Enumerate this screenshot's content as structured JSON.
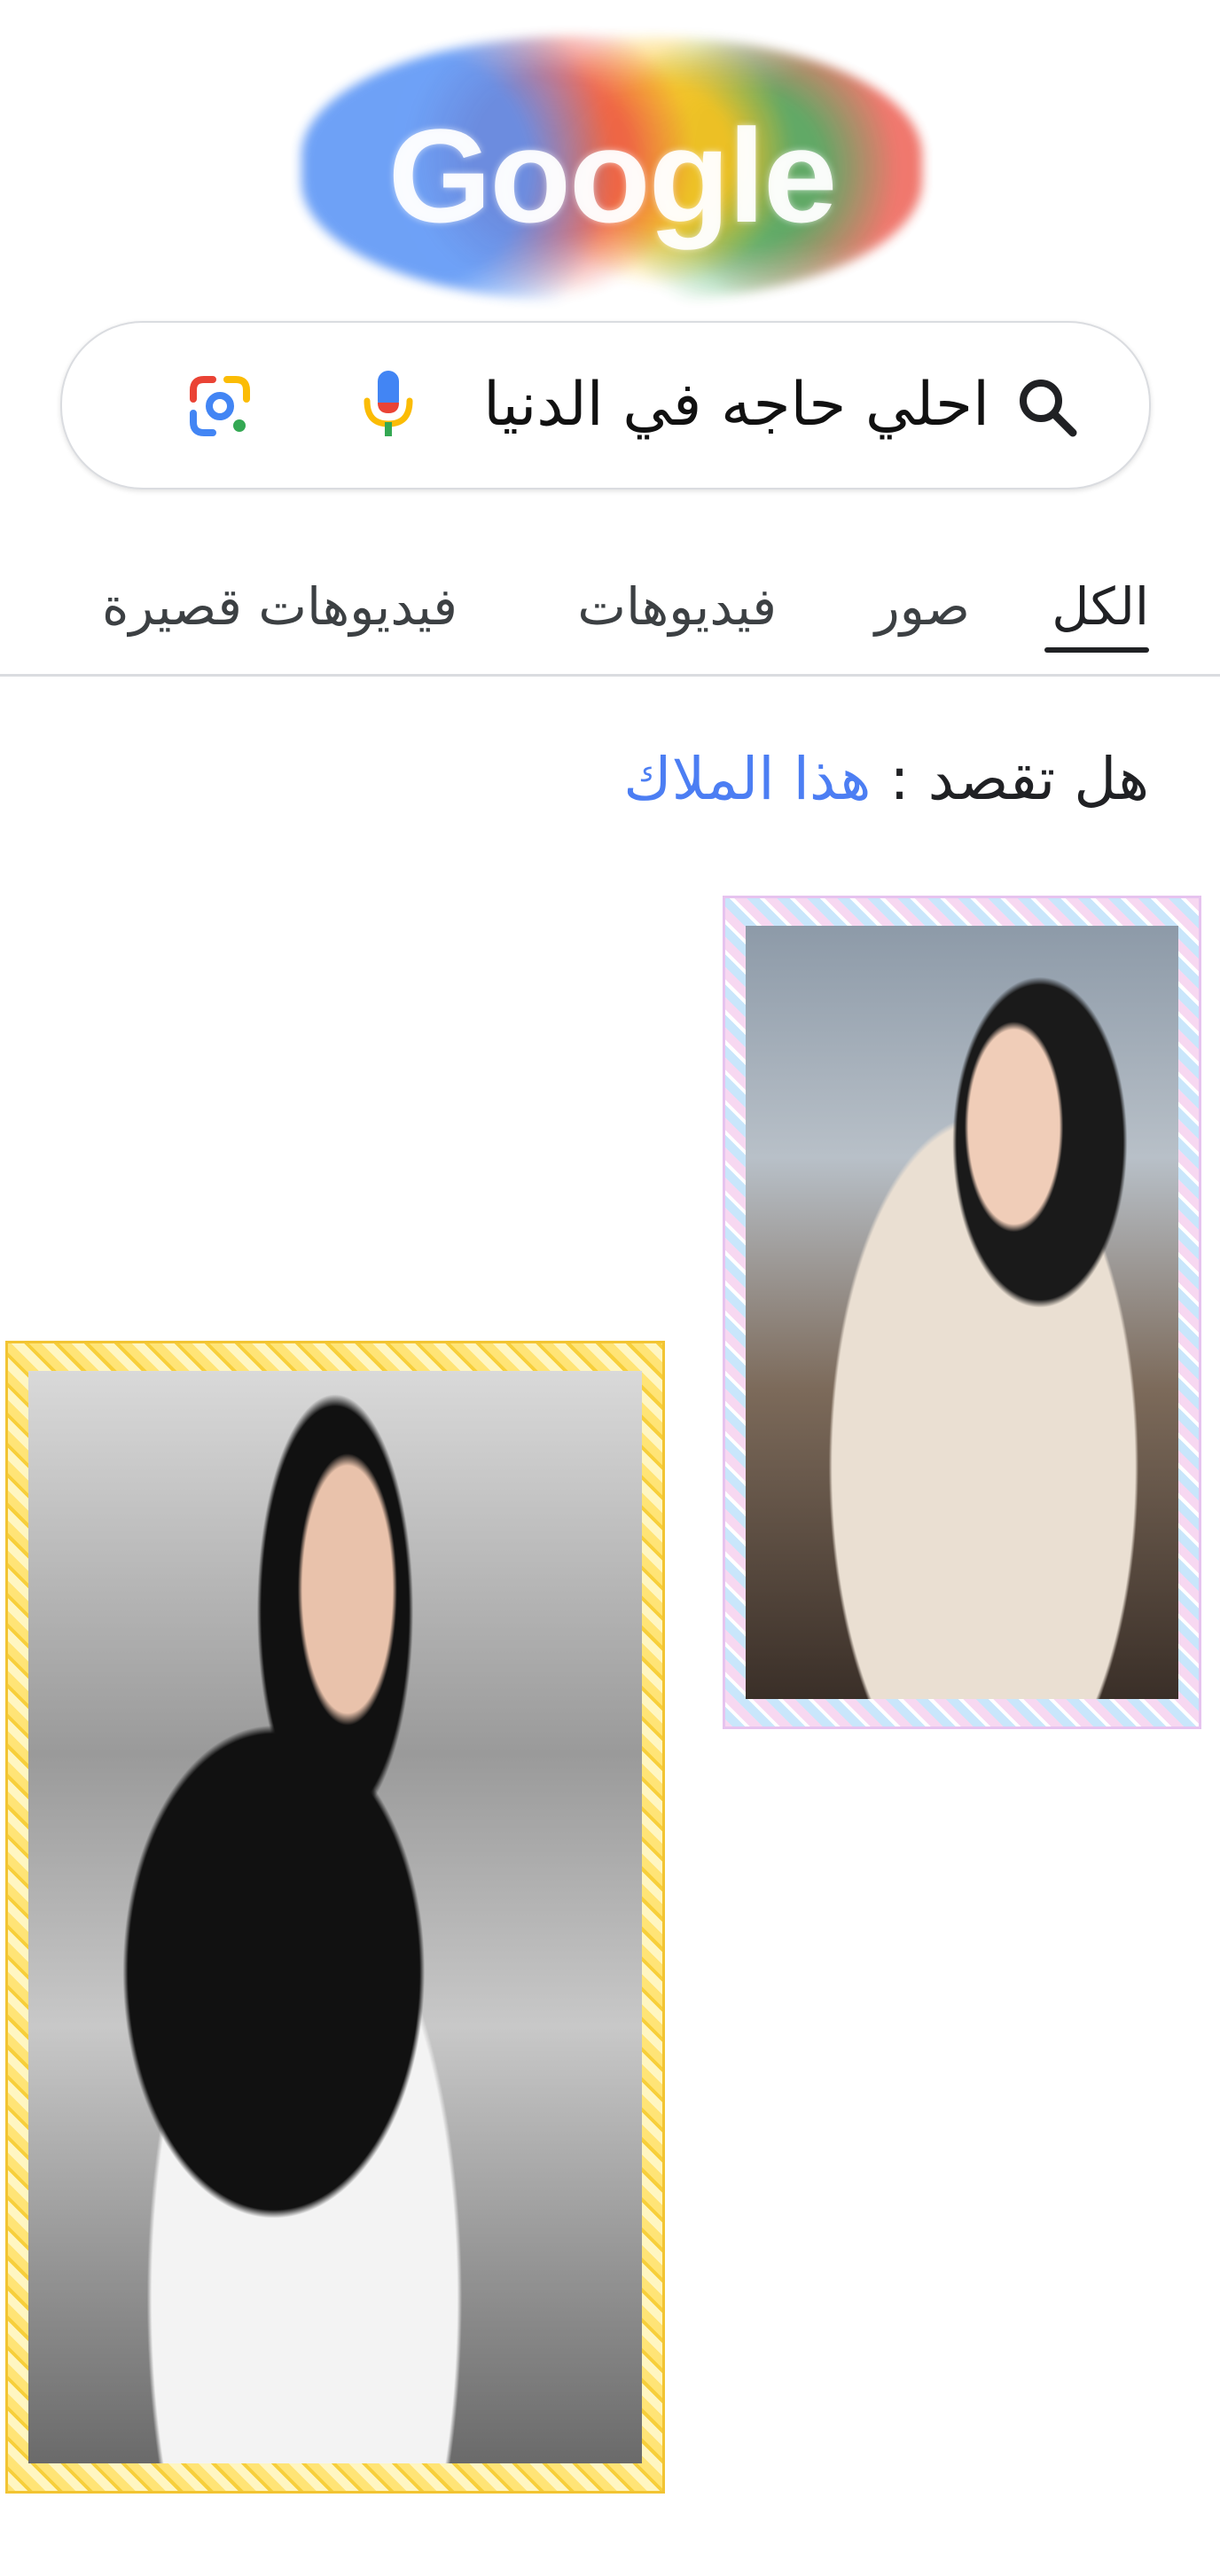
{
  "logo": {
    "text": "Google"
  },
  "search": {
    "query": "احلي حاجه في الدنيا",
    "search_icon": "search-icon",
    "mic_icon": "mic-icon",
    "lens_icon": "camera-lens-icon"
  },
  "tabs": [
    {
      "label": "الكل",
      "active": true
    },
    {
      "label": "صور",
      "active": false
    },
    {
      "label": "فيديوهات",
      "active": false
    },
    {
      "label": "فيديوهات قصيرة",
      "active": false
    }
  ],
  "did_you_mean": {
    "label": "هل تقصد :",
    "suggestion": "هذا الملاك"
  },
  "results": {
    "images": [
      {
        "name": "photo-1",
        "frame": "pastel-lace"
      },
      {
        "name": "photo-2",
        "frame": "gold-lace"
      }
    ]
  },
  "colors": {
    "link": "#4c7ef3",
    "text": "#202124",
    "border": "#dadce0"
  }
}
